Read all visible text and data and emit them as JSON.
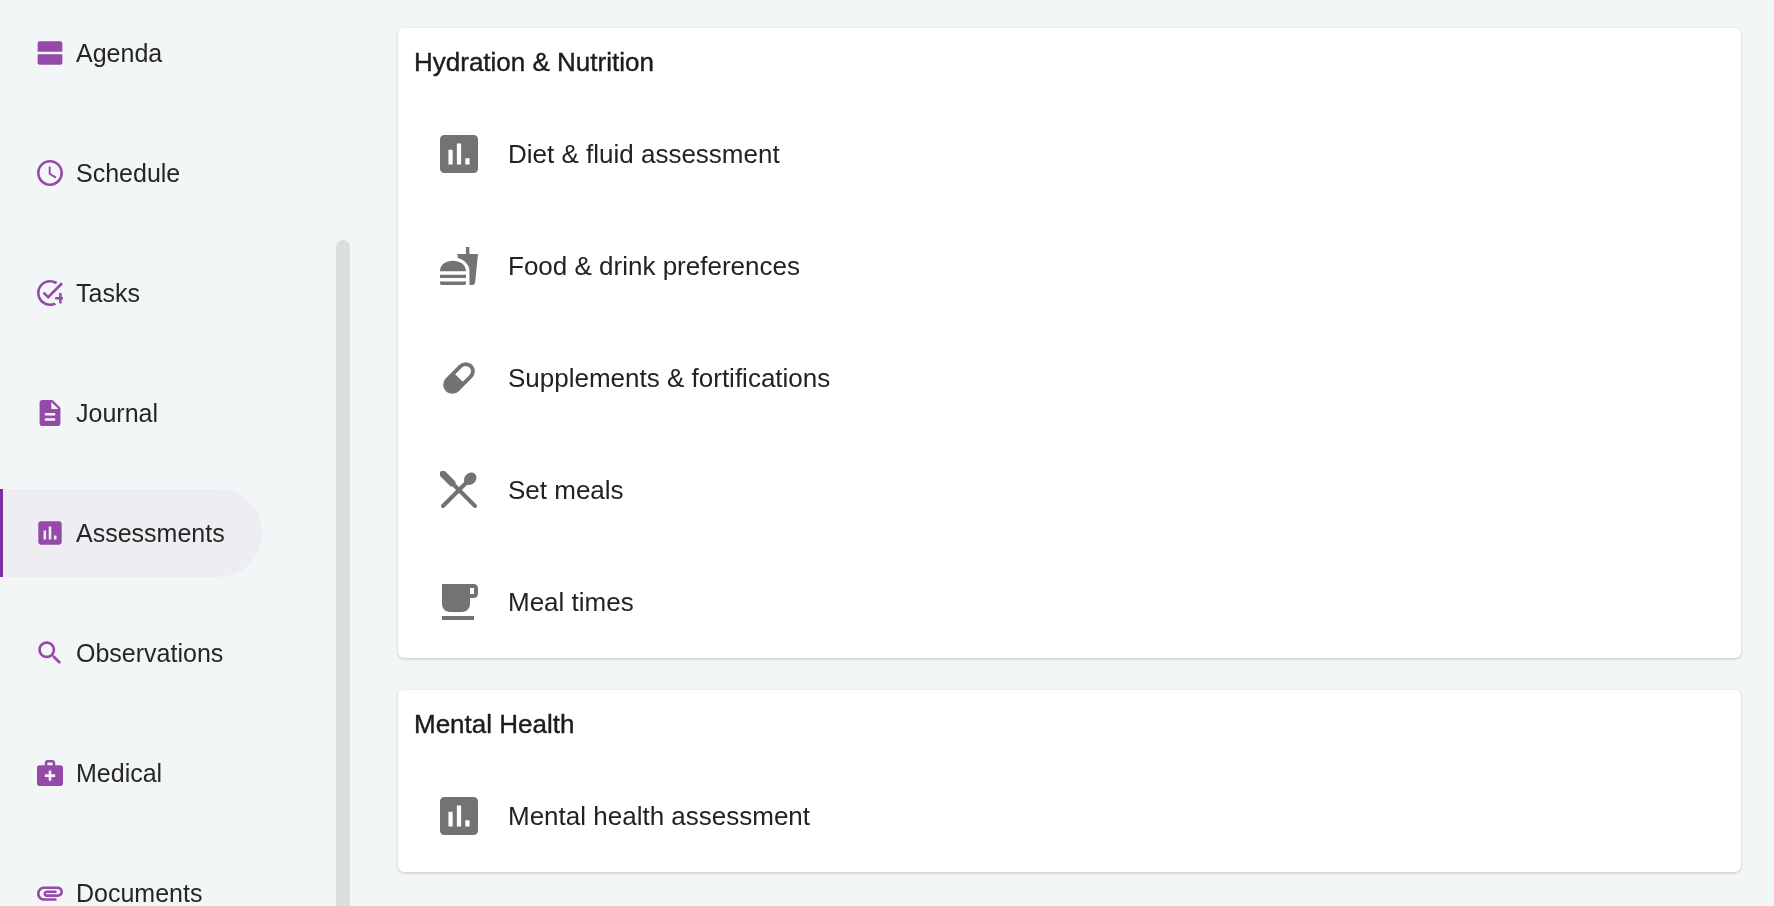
{
  "sidebar": {
    "items": [
      {
        "label": "Agenda",
        "selected": false
      },
      {
        "label": "Schedule",
        "selected": false
      },
      {
        "label": "Tasks",
        "selected": false
      },
      {
        "label": "Journal",
        "selected": false
      },
      {
        "label": "Assessments",
        "selected": true
      },
      {
        "label": "Observations",
        "selected": false
      },
      {
        "label": "Medical",
        "selected": false
      },
      {
        "label": "Documents",
        "selected": false
      }
    ]
  },
  "sections": [
    {
      "title": "Hydration & Nutrition",
      "items": [
        {
          "label": "Diet & fluid assessment"
        },
        {
          "label": "Food & drink preferences"
        },
        {
          "label": "Supplements & fortifications"
        },
        {
          "label": "Set meals"
        },
        {
          "label": "Meal times"
        }
      ]
    },
    {
      "title": "Mental Health",
      "items": [
        {
          "label": "Mental health assessment"
        }
      ]
    }
  ]
}
